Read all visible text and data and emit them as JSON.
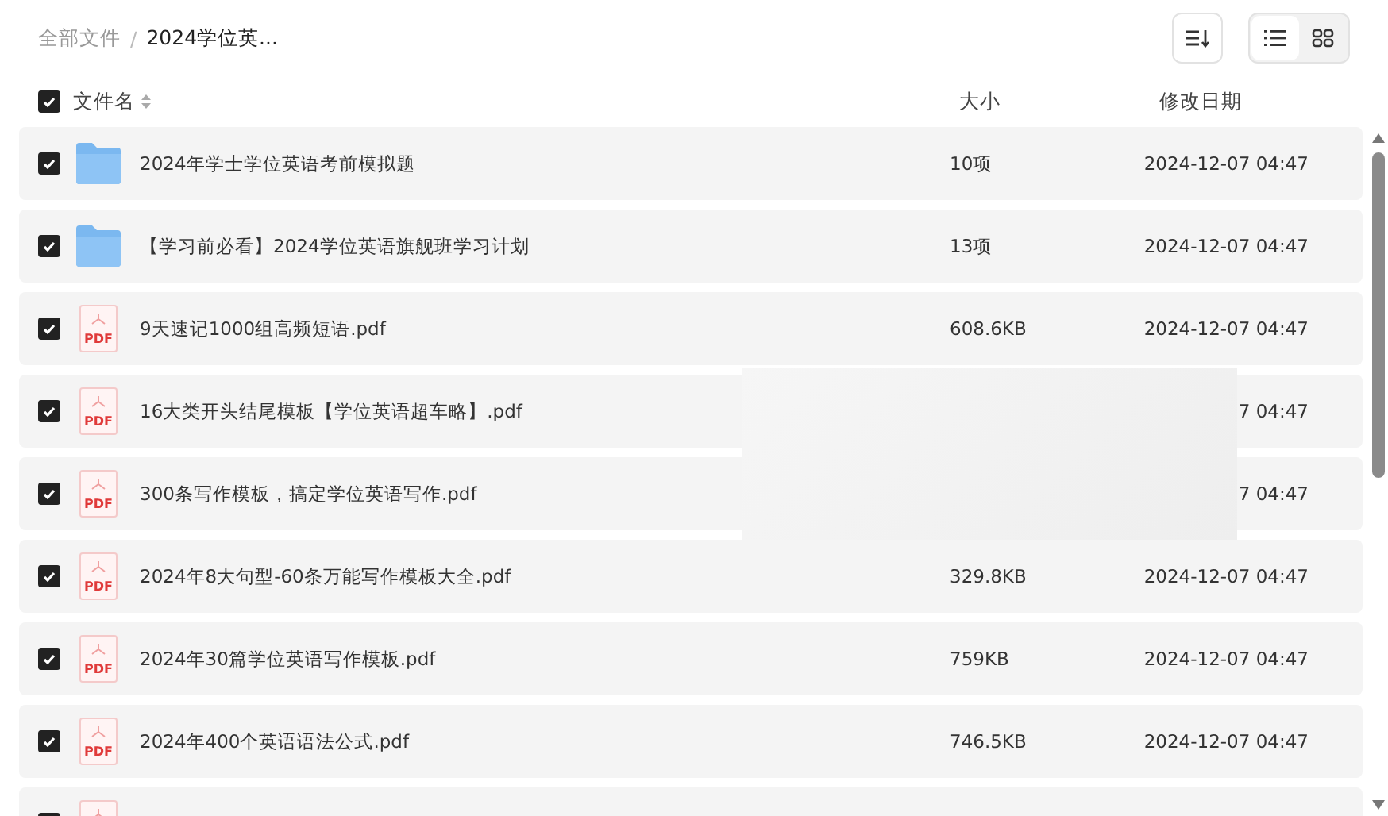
{
  "breadcrumb": {
    "root": "全部文件",
    "separator": "/",
    "current": "2024学位英..."
  },
  "view_toggle": [
    {
      "kind": "list",
      "selected": true
    },
    {
      "kind": "grid",
      "selected": false
    }
  ],
  "header": {
    "all_checked": true,
    "columns": [
      "文件名",
      "大小",
      "修改日期"
    ]
  },
  "rows": [
    {
      "kind": "folder",
      "checked": true,
      "name": "2024年学士学位英语考前模拟题",
      "size": "10项",
      "date": "2024-12-07 04:47"
    },
    {
      "kind": "folder",
      "checked": true,
      "name": "【学习前必看】2024学位英语旗舰班学习计划",
      "size": "13项",
      "date": "2024-12-07 04:47"
    },
    {
      "kind": "pdf",
      "checked": true,
      "icon_text": "PDF",
      "name": "9天速记1000组高频短语.pdf",
      "size": "608.6KB",
      "date": "2024-12-07 04:47"
    },
    {
      "kind": "pdf",
      "checked": true,
      "icon_text": "PDF",
      "name": "16大类开头结尾模板【学位英语超车略】.pdf",
      "date": "7 04:47"
    },
    {
      "kind": "pdf",
      "checked": true,
      "icon_text": "PDF",
      "name": "300条写作模板，搞定学位英语写作.pdf",
      "date": "7 04:47"
    },
    {
      "kind": "pdf",
      "checked": true,
      "icon_text": "PDF",
      "name": "2024年8大句型-60条万能写作模板大全.pdf",
      "size": "329.8KB",
      "date": "2024-12-07 04:47"
    },
    {
      "kind": "pdf",
      "checked": true,
      "icon_text": "PDF",
      "name": "2024年30篇学位英语写作模板.pdf",
      "size": "759KB",
      "date": "2024-12-07 04:47"
    },
    {
      "kind": "pdf",
      "checked": true,
      "icon_text": "PDF",
      "name": "2024年400个英语语法公式.pdf",
      "size": "746.5KB",
      "date": "2024-12-07 04:47"
    },
    {
      "kind": "pdf",
      "checked": true
    }
  ]
}
